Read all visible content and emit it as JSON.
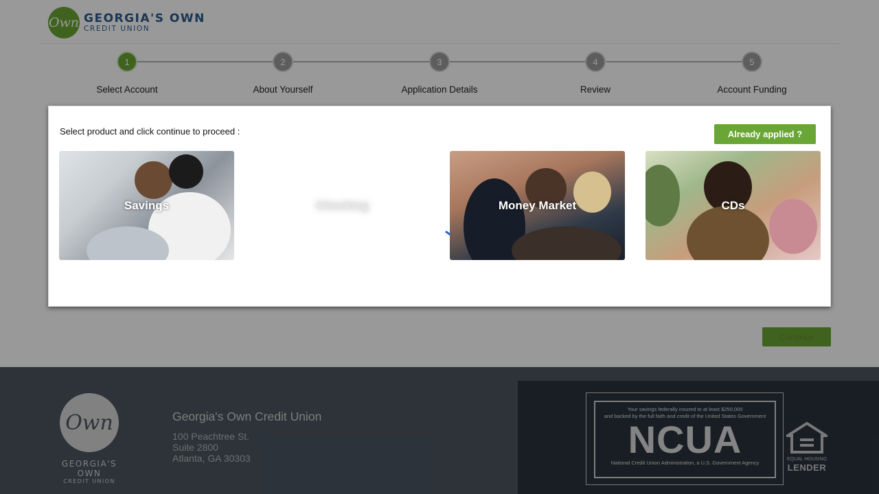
{
  "brand": {
    "logo_mark": "Own",
    "name": "GEORGIA'S OWN",
    "subname": "CREDIT UNION",
    "color": "#6aa635",
    "text_color": "#2a5a8c"
  },
  "stepper": {
    "steps": [
      {
        "number": "1",
        "label": "Select Account",
        "active": true
      },
      {
        "number": "2",
        "label": "About Yourself",
        "active": false
      },
      {
        "number": "3",
        "label": "Application Details",
        "active": false
      },
      {
        "number": "4",
        "label": "Review",
        "active": false
      },
      {
        "number": "5",
        "label": "Account Funding",
        "active": false
      }
    ]
  },
  "card": {
    "instruction": "Select product and click continue to proceed :",
    "already_applied_label": "Already applied ?",
    "products": [
      {
        "label": "Savings"
      },
      {
        "label": "Checking"
      },
      {
        "label": "Money Market"
      },
      {
        "label": "CDs"
      }
    ]
  },
  "continue_label": "Continue",
  "footer": {
    "logo_mark": "Own",
    "logo_title": "GEORGIA'S OWN",
    "logo_sub": "CREDIT UNION",
    "org_name": "Georgia's Own Credit Union",
    "address_line1": "100 Peachtree St.",
    "address_line2": "Suite 2800",
    "address_line3": "Atlanta, GA 30303",
    "ncua_top_line1": "Your savings federally insured to at least $250,000",
    "ncua_top_line2": "and backed by the full faith and credit of the United States Government",
    "ncua_big": "NCUA",
    "ncua_bottom": "National Credit Union Administration, a U.S. Government Agency",
    "ehl_small": "EQUAL HOUSING",
    "ehl_big": "LENDER"
  }
}
